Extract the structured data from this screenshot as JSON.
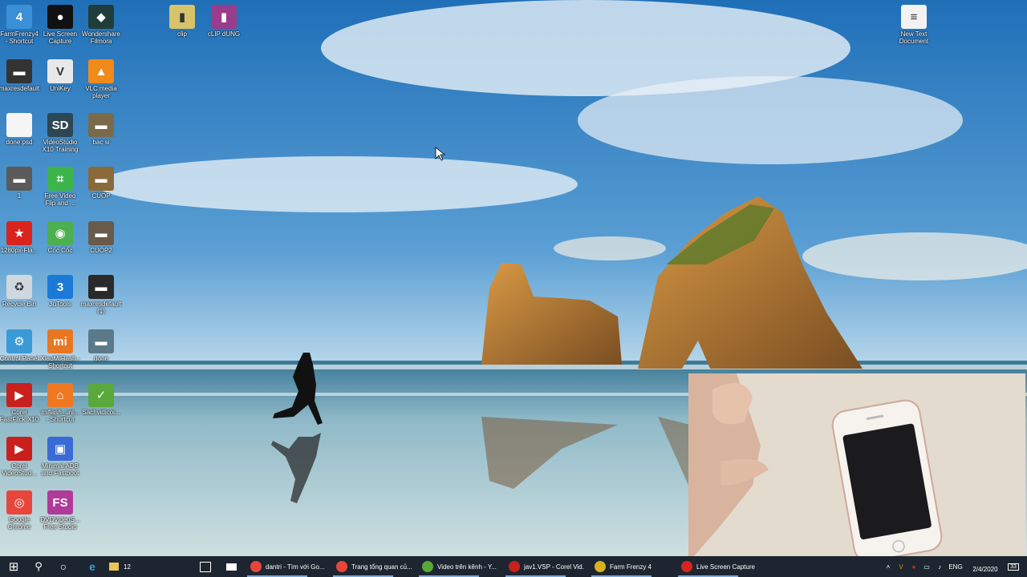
{
  "desktop": {
    "icons": [
      {
        "label": "FarmFrenzy4\n- Shortcut",
        "glyph": "4",
        "color": "#3a8fd6"
      },
      {
        "label": "Live Screen\nCapture",
        "glyph": "●",
        "color": "#111111"
      },
      {
        "label": "Wondershare\nFilmora",
        "glyph": "◆",
        "color": "#1f3d3a"
      },
      {
        "label": "clip",
        "glyph": "▮",
        "color": "#d6c36a"
      },
      {
        "label": "cLIP dUNG",
        "glyph": "▮",
        "color": "#9a3c8c"
      },
      {
        "label": "New Text\nDocument",
        "glyph": "≡",
        "color": "#f2f2f2"
      },
      {
        "label": "maxresdefault",
        "glyph": "▬",
        "color": "#333333"
      },
      {
        "label": "UniKey",
        "glyph": "V",
        "color": "#e8e8e8"
      },
      {
        "label": "VLC media\nplayer",
        "glyph": "▲",
        "color": "#f08a18"
      },
      {
        "label": "done.psd",
        "glyph": "",
        "color": "#f5f5f5"
      },
      {
        "label": "VideoStudio\nX10 Training",
        "glyph": "SD",
        "color": "#2d4654"
      },
      {
        "label": "bac si",
        "glyph": "▬",
        "color": "#7a6a4a"
      },
      {
        "label": "1",
        "glyph": "▬",
        "color": "#5a5a5a"
      },
      {
        "label": "Free Video\nFlip and ...",
        "glyph": "⌗",
        "color": "#3cb44a"
      },
      {
        "label": "CUOP",
        "glyph": "▬",
        "color": "#8a6a3a"
      },
      {
        "label": "1280px-Fla...",
        "glyph": "★",
        "color": "#d8241c"
      },
      {
        "label": "Cốc Cốc",
        "glyph": "◉",
        "color": "#4caf50"
      },
      {
        "label": "CUOP2",
        "glyph": "▬",
        "color": "#6a5a4a"
      },
      {
        "label": "Recycle Bin",
        "glyph": "♻",
        "color": "#cfd8de"
      },
      {
        "label": "3uTools",
        "glyph": "3",
        "color": "#1a7ad6"
      },
      {
        "label": "maxresdefault (1)",
        "glyph": "▬",
        "color": "#2a2a2a"
      },
      {
        "label": "Control Panel",
        "glyph": "⚙",
        "color": "#3a9ad6"
      },
      {
        "label": "XiaoMiFlash -\nShortcut",
        "glyph": "mi",
        "color": "#e87722"
      },
      {
        "label": "done",
        "glyph": "▬",
        "color": "#5a7a8a"
      },
      {
        "label": "Corel\nFastFlick X10",
        "glyph": "▶",
        "color": "#c8201c"
      },
      {
        "label": "miflash_unl...\n- Shortcut",
        "glyph": "⌂",
        "color": "#f07820"
      },
      {
        "label": "Sachvidicoi...",
        "glyph": "✓",
        "color": "#5aa83a"
      },
      {
        "label": "Corel\nVideoStud...",
        "glyph": "▶",
        "color": "#c8201c"
      },
      {
        "label": "Minimal ADB\nand Fastboot",
        "glyph": "▣",
        "color": "#3a6ad6"
      },
      {
        "label": "Google\nChrome",
        "glyph": "◎",
        "color": "#e8453c"
      },
      {
        "label": "DVDVideoS...\nFree Studio",
        "glyph": "FS",
        "color": "#b03a9a"
      }
    ]
  },
  "taskbar": {
    "start_glyph": "⊞",
    "search_glyph": "⚲",
    "cortana_glyph": "○",
    "folder_count": "12",
    "apps": [
      {
        "label": "dantri - Tìm với Go...",
        "color": "#e8453c"
      },
      {
        "label": "Trang tổng quan củ...",
        "color": "#e8453c"
      },
      {
        "label": "Video trên kênh - Y...",
        "color": "#5aa83a"
      },
      {
        "label": "jav1.VSP - Corel Vid...",
        "color": "#c8201c"
      },
      {
        "label": "Farm Frenzy 4",
        "color": "#d8b020"
      },
      {
        "label": "Live Screen Capture",
        "color": "#d8241c"
      }
    ],
    "tray": {
      "language": "ENG",
      "date": "2/4/2020",
      "notification_count": "33"
    }
  },
  "colors": {
    "taskbar_bg": "#1d2630",
    "accent": "#7aa9d8"
  }
}
